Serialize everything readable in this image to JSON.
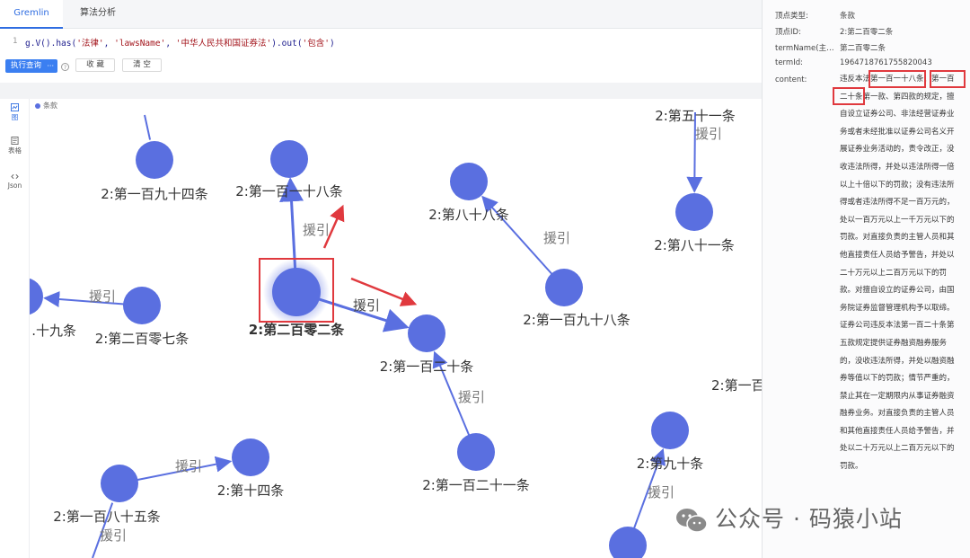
{
  "tabs": [
    {
      "label": "Gremlin 分析",
      "active": true
    },
    {
      "label": "算法分析",
      "active": false
    }
  ],
  "editor": {
    "line_number": "1",
    "query_parts": [
      {
        "t": "g.V().has(",
        "s": false
      },
      {
        "t": "'法律'",
        "s": true
      },
      {
        "t": ", ",
        "s": false
      },
      {
        "t": "'lawsName'",
        "s": true
      },
      {
        "t": ", ",
        "s": false
      },
      {
        "t": "'中华人民共和国证券法'",
        "s": true
      },
      {
        "t": ").out(",
        "s": false
      },
      {
        "t": "'包含'",
        "s": true
      },
      {
        "t": ")",
        "s": false
      }
    ]
  },
  "toolbar": {
    "run_label": "执行查询",
    "run_more": "···",
    "help": "?",
    "favorite_label": "收 藏",
    "clear_label": "清 空"
  },
  "sidenav": {
    "graph_label": "图",
    "table_label": "表格",
    "json_label": "Json"
  },
  "legend": {
    "label": "条款"
  },
  "colors": {
    "node": "#5a6fe0",
    "edge": "#5a6fe0",
    "accent": "#2f6de1",
    "highlight": "#e0393e"
  },
  "graph": {
    "edge_label": "援引",
    "selected_node": "2:第二百零二条",
    "nodes": [
      {
        "label": "2:第一百九十四条"
      },
      {
        "label": "2:第一百一十八条"
      },
      {
        "label": "2:第八十八条"
      },
      {
        "label": "2:第五十一条"
      },
      {
        "label": "2:第八十一条"
      },
      {
        "label": ".十九条"
      },
      {
        "label": "2:第二百零七条"
      },
      {
        "label": "2:第二百零二条"
      },
      {
        "label": "2:第一百九十八条"
      },
      {
        "label": "2:第一百二十条"
      },
      {
        "label": "2:第一百二十一条"
      },
      {
        "label": "2:第十四条"
      },
      {
        "label": "2:第一百八十五条"
      },
      {
        "label": "2:第九十条"
      },
      {
        "label": "2:第一百"
      },
      {
        "label": ""
      }
    ]
  },
  "details": {
    "props": [
      {
        "key": "顶点类型:",
        "value": "条款"
      },
      {
        "key": "顶点ID:",
        "value": "2:第二百零二条"
      },
      {
        "key": "termName(主键)...",
        "value": "第二百零二条"
      },
      {
        "key": "termId:",
        "value": "1964718761755820043"
      }
    ],
    "content_key": "content:",
    "content_lines": [
      "违反本法第一百一十八条、第一百",
      "二十条第一款、第四款的规定，擅",
      "自设立证券公司、非法经营证券业",
      "务或者未经批准以证券公司名义开",
      "展证券业务活动的，责令改正，没",
      "收违法所得，并处以违法所得一倍",
      "以上十倍以下的罚款；没有违法所",
      "得或者违法所得不足一百万元的，",
      "处以一百万元以上一千万元以下的",
      "罚款。对直接负责的主管人员和其",
      "他直接责任人员给予警告，并处以",
      "二十万元以上二百万元以下的罚",
      "款。对擅自设立的证券公司，由国",
      "务院证券监督管理机构予以取缔。",
      "证券公司违反本法第一百二十条第",
      "五款规定提供证券融资融券服务",
      "的，没收违法所得，并处以融资融",
      "券等值以下的罚款；情节严重的，",
      "禁止其在一定期限内从事证券融资",
      "融券业务。对直接负责的主管人员",
      "和其他直接责任人员给予警告，并",
      "处以二十万元以上二百万元以下的",
      "罚款。"
    ]
  },
  "watermark": {
    "text": "公众号 · 码猿小站"
  }
}
